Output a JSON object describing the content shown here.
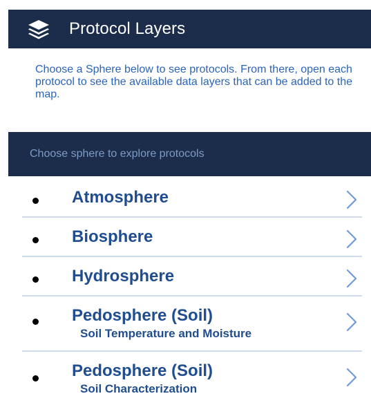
{
  "header": {
    "title": "Protocol Layers",
    "icon": "layers-icon"
  },
  "intro": {
    "text": "Choose a Sphere below to see protocols. From there, open each protocol to see the available data layers that can be added to the map."
  },
  "section": {
    "label": "Choose sphere to explore protocols"
  },
  "spheres": [
    {
      "name": "Atmosphere",
      "sub": ""
    },
    {
      "name": "Biosphere",
      "sub": ""
    },
    {
      "name": "Hydrosphere",
      "sub": ""
    },
    {
      "name": "Pedosphere (Soil)",
      "sub": "Soil Temperature and Moisture"
    },
    {
      "name": "Pedosphere (Soil)",
      "sub": "Soil Characterization"
    }
  ],
  "colors": {
    "header_bg": "#1b2d4a",
    "accent_text": "#2b64b8",
    "item_text": "#1f4d8f",
    "chevron": "#6f9ad8",
    "divider": "#cfdcee"
  }
}
